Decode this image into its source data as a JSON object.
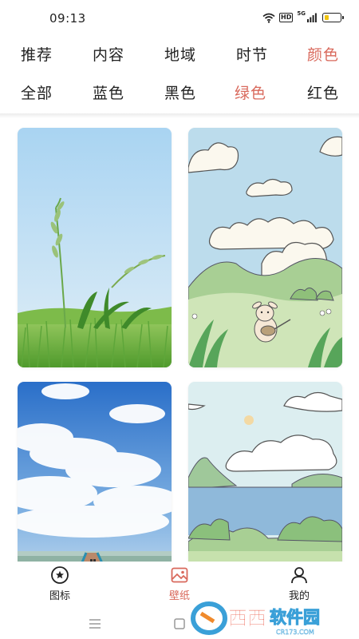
{
  "status_bar": {
    "time": "09:13",
    "wifi_icon": "wifi-icon",
    "hd_label": "HD",
    "signal_label": "5G",
    "battery_level": 0.3,
    "battery_color": "#f1c40f"
  },
  "category_tabs": [
    {
      "label": "推荐",
      "active": false
    },
    {
      "label": "内容",
      "active": false
    },
    {
      "label": "地域",
      "active": false
    },
    {
      "label": "时节",
      "active": false
    },
    {
      "label": "颜色",
      "active": true
    }
  ],
  "color_tabs": [
    {
      "label": "全部",
      "active": false
    },
    {
      "label": "蓝色",
      "active": false
    },
    {
      "label": "黑色",
      "active": false
    },
    {
      "label": "绿色",
      "active": true
    },
    {
      "label": "红色",
      "active": false
    }
  ],
  "accent_color": "#d9695c",
  "active_pill_color": "#f7e1dc",
  "wallpapers": [
    {
      "subject": "grass-under-blue-sky"
    },
    {
      "subject": "cartoon-rabbit-in-meadow"
    },
    {
      "subject": "pier-under-cloudy-sky"
    },
    {
      "subject": "cartoon-lake-landscape"
    }
  ],
  "bottom_nav": [
    {
      "label": "图标",
      "icon": "star-circle-icon",
      "active": false
    },
    {
      "label": "壁纸",
      "icon": "wallpaper-icon",
      "active": true
    },
    {
      "label": "我的",
      "icon": "person-icon",
      "active": false
    }
  ],
  "system_nav": {
    "menu_icon": "menu-icon",
    "home_icon": "home-square-icon"
  },
  "watermark": {
    "text": "西西软件园",
    "subtext": "CR173.COM"
  }
}
